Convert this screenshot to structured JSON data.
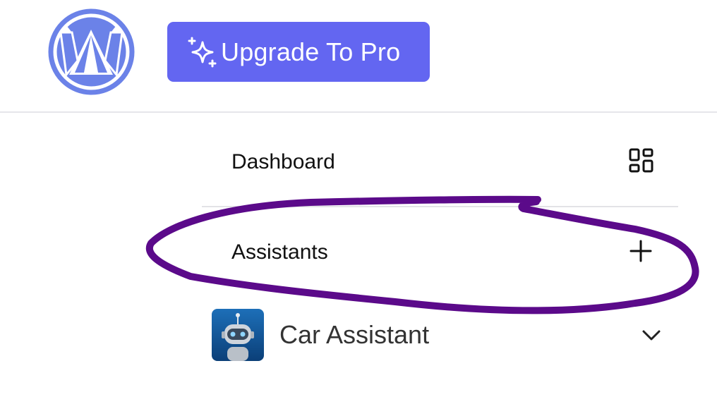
{
  "header": {
    "logo_icon": "origami-cat-logo-icon",
    "upgrade_label": "Upgrade To Pro",
    "upgrade_icon": "sparkles-icon",
    "accent_color": "#6366f1"
  },
  "nav": {
    "dashboard": {
      "label": "Dashboard",
      "icon": "grid-icon"
    },
    "assistants": {
      "label": "Assistants",
      "icon": "plus-icon"
    }
  },
  "assistants_list": [
    {
      "name": "Car Assistant",
      "avatar_icon": "robot-avatar-icon",
      "toggle_icon": "chevron-down-icon"
    }
  ],
  "annotation": {
    "type": "hand-drawn-circle",
    "color": "#5b0a8a",
    "target": "Assistants"
  }
}
